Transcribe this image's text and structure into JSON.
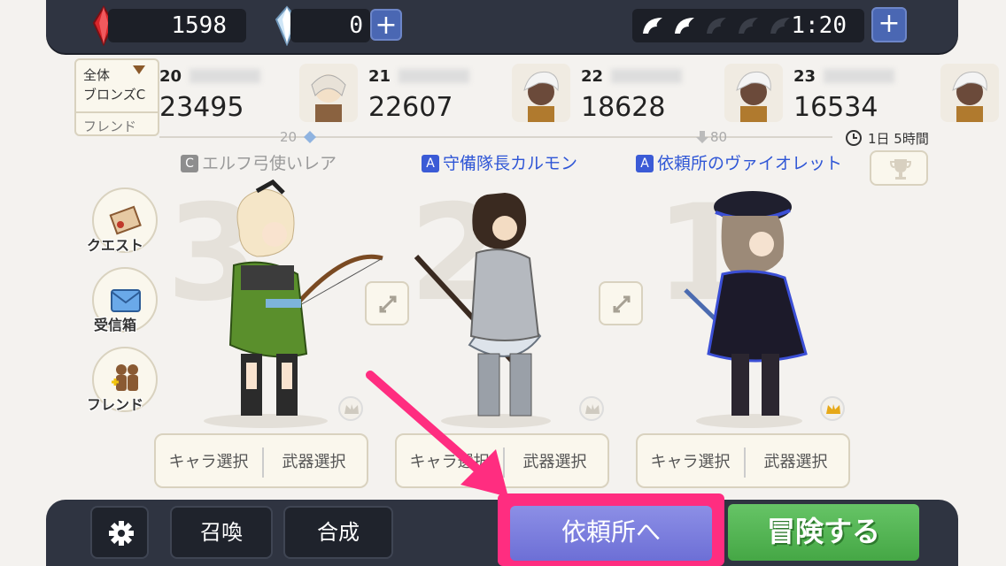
{
  "top_bar": {
    "red_gem": "1598",
    "crystal": "0",
    "stamina_time": "1:20",
    "plus_label": "+",
    "wings_filled": 2,
    "wings_total": 5
  },
  "ranking": {
    "filter_scope": "全体",
    "filter_league": "ブロンズC",
    "filter_friend": "フレンド",
    "entries": [
      {
        "rank": "20",
        "score": "23495"
      },
      {
        "rank": "21",
        "score": "22607"
      },
      {
        "rank": "22",
        "score": "18628"
      },
      {
        "rank": "23",
        "score": "16534"
      }
    ],
    "stage_left": "20",
    "stage_right": "80",
    "time_left": "1日 5時間"
  },
  "party": [
    {
      "slot": "3",
      "grade": "C",
      "grade_color": "#8e8e8e",
      "name": "エルフ弓使いレア",
      "name_color": "#9a9a9a",
      "crown_gold": false
    },
    {
      "slot": "2",
      "grade": "A",
      "grade_color": "#3b5bd6",
      "name": "守備隊長カルモン",
      "name_color": "#2f56d6",
      "crown_gold": false
    },
    {
      "slot": "1",
      "grade": "A",
      "grade_color": "#3b5bd6",
      "name": "依頼所のヴァイオレット",
      "name_color": "#2f56d6",
      "crown_gold": true
    }
  ],
  "select": {
    "chara": "キャラ選択",
    "weapon": "武器選択"
  },
  "side_menu": {
    "quest": "クエスト",
    "inbox": "受信箱",
    "friend": "フレンド"
  },
  "bottom": {
    "summon": "召喚",
    "fusion": "合成",
    "guild": "依頼所へ",
    "adventure": "冒険する"
  },
  "colors": {
    "bar": "#2f3441",
    "highlight": "#ff2d80",
    "guild": "#7a7cdc",
    "adventure": "#52b352"
  }
}
